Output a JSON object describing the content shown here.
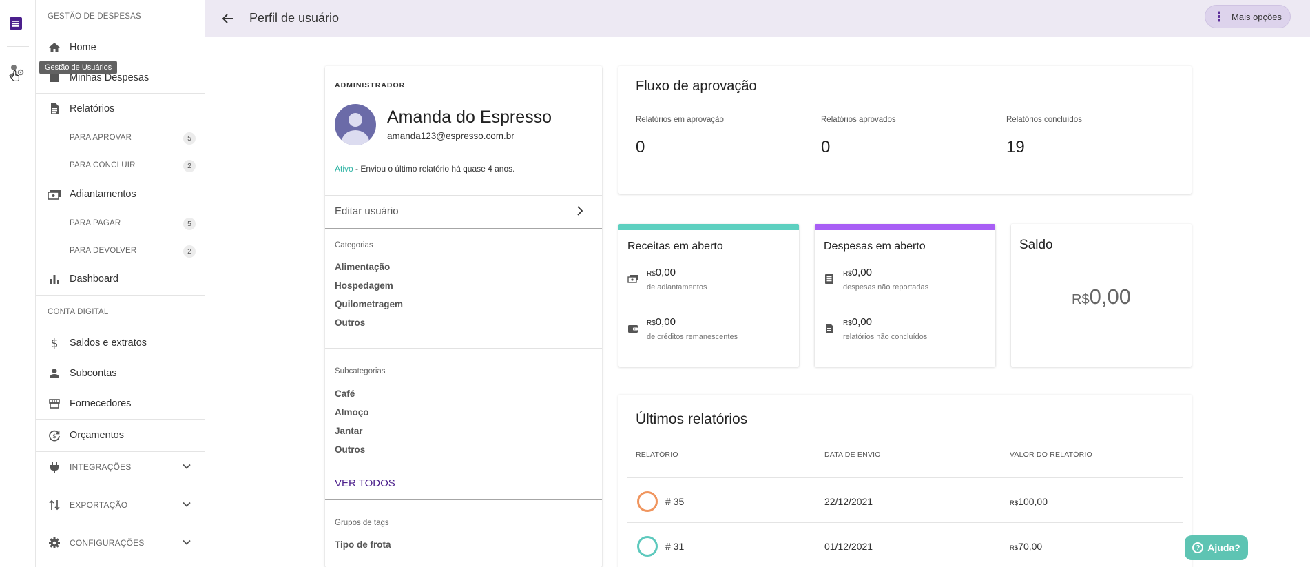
{
  "rail": {
    "tooltip": "Gestão de Usuários"
  },
  "sidebar": {
    "section1": "GESTÃO DE DESPESAS",
    "home": "Home",
    "my_expenses": "Minhas Despesas",
    "reports": "Relatórios",
    "reports_sub": [
      {
        "label": "PARA APROVAR",
        "count": "5"
      },
      {
        "label": "PARA CONCLUIR",
        "count": "2"
      }
    ],
    "advances": "Adiantamentos",
    "advances_sub": [
      {
        "label": "PARA PAGAR",
        "count": "5"
      },
      {
        "label": "PARA DEVOLVER",
        "count": "2"
      }
    ],
    "dashboard": "Dashboard",
    "section2": "CONTA DIGITAL",
    "balances": "Saldos e extratos",
    "subaccounts": "Subcontas",
    "suppliers": "Fornecedores",
    "budgets": "Orçamentos",
    "integrations": "INTEGRAÇÕES",
    "export": "EXPORTAÇÃO",
    "settings": "CONFIGURAÇÕES"
  },
  "header": {
    "title": "Perfil de usuário",
    "more": "Mais opções"
  },
  "profile": {
    "role": "ADMINISTRADOR",
    "name": "Amanda do Espresso",
    "email": "amanda123@espresso.com.br",
    "status_active": "Ativo",
    "status_text": " - Enviou o último relatório há quase 4 anos.",
    "edit": "Editar usuário",
    "categories_title": "Categorias",
    "categories": [
      "Alimentação",
      "Hospedagem",
      "Quilometragem",
      "Outros"
    ],
    "subcategories_title": "Subcategorias",
    "subcategories": [
      "Café",
      "Almoço",
      "Jantar",
      "Outros"
    ],
    "see_all": "VER TODOS",
    "tag_groups_title": "Grupos de tags",
    "tag_groups": [
      "Tipo de frota"
    ]
  },
  "flow": {
    "title": "Fluxo de aprovação",
    "cols": [
      {
        "label": "Relatórios em aprovação",
        "value": "0"
      },
      {
        "label": "Relatórios aprovados",
        "value": "0"
      },
      {
        "label": "Relatórios concluídos",
        "value": "19"
      }
    ]
  },
  "receitas": {
    "title": "Receitas em aberto",
    "color": "#5dd0c0",
    "rows": [
      {
        "currency": "R$",
        "amount": "0,00",
        "desc": "de adiantamentos"
      },
      {
        "currency": "R$",
        "amount": "0,00",
        "desc": "de créditos remanescentes"
      }
    ]
  },
  "despesas": {
    "title": "Despesas em aberto",
    "color": "#a85ef5",
    "rows": [
      {
        "currency": "R$",
        "amount": "0,00",
        "desc": "despesas não reportadas"
      },
      {
        "currency": "R$",
        "amount": "0,00",
        "desc": "relatórios não concluídos"
      }
    ]
  },
  "saldo": {
    "title": "Saldo",
    "currency": "R$",
    "amount": "0,00"
  },
  "reports": {
    "title": "Últimos relatórios",
    "headers": [
      "RELATÓRIO",
      "DATA DE ENVIO",
      "VALOR DO RELATÓRIO"
    ],
    "rows": [
      {
        "num": "# 35",
        "date": "22/12/2021",
        "currency": "R$",
        "value": "100,00",
        "color": "#f0955e"
      },
      {
        "num": "# 31",
        "date": "01/12/2021",
        "currency": "R$",
        "value": "70,00",
        "color": "#5dc9bd"
      }
    ]
  },
  "help": "Ajuda?"
}
